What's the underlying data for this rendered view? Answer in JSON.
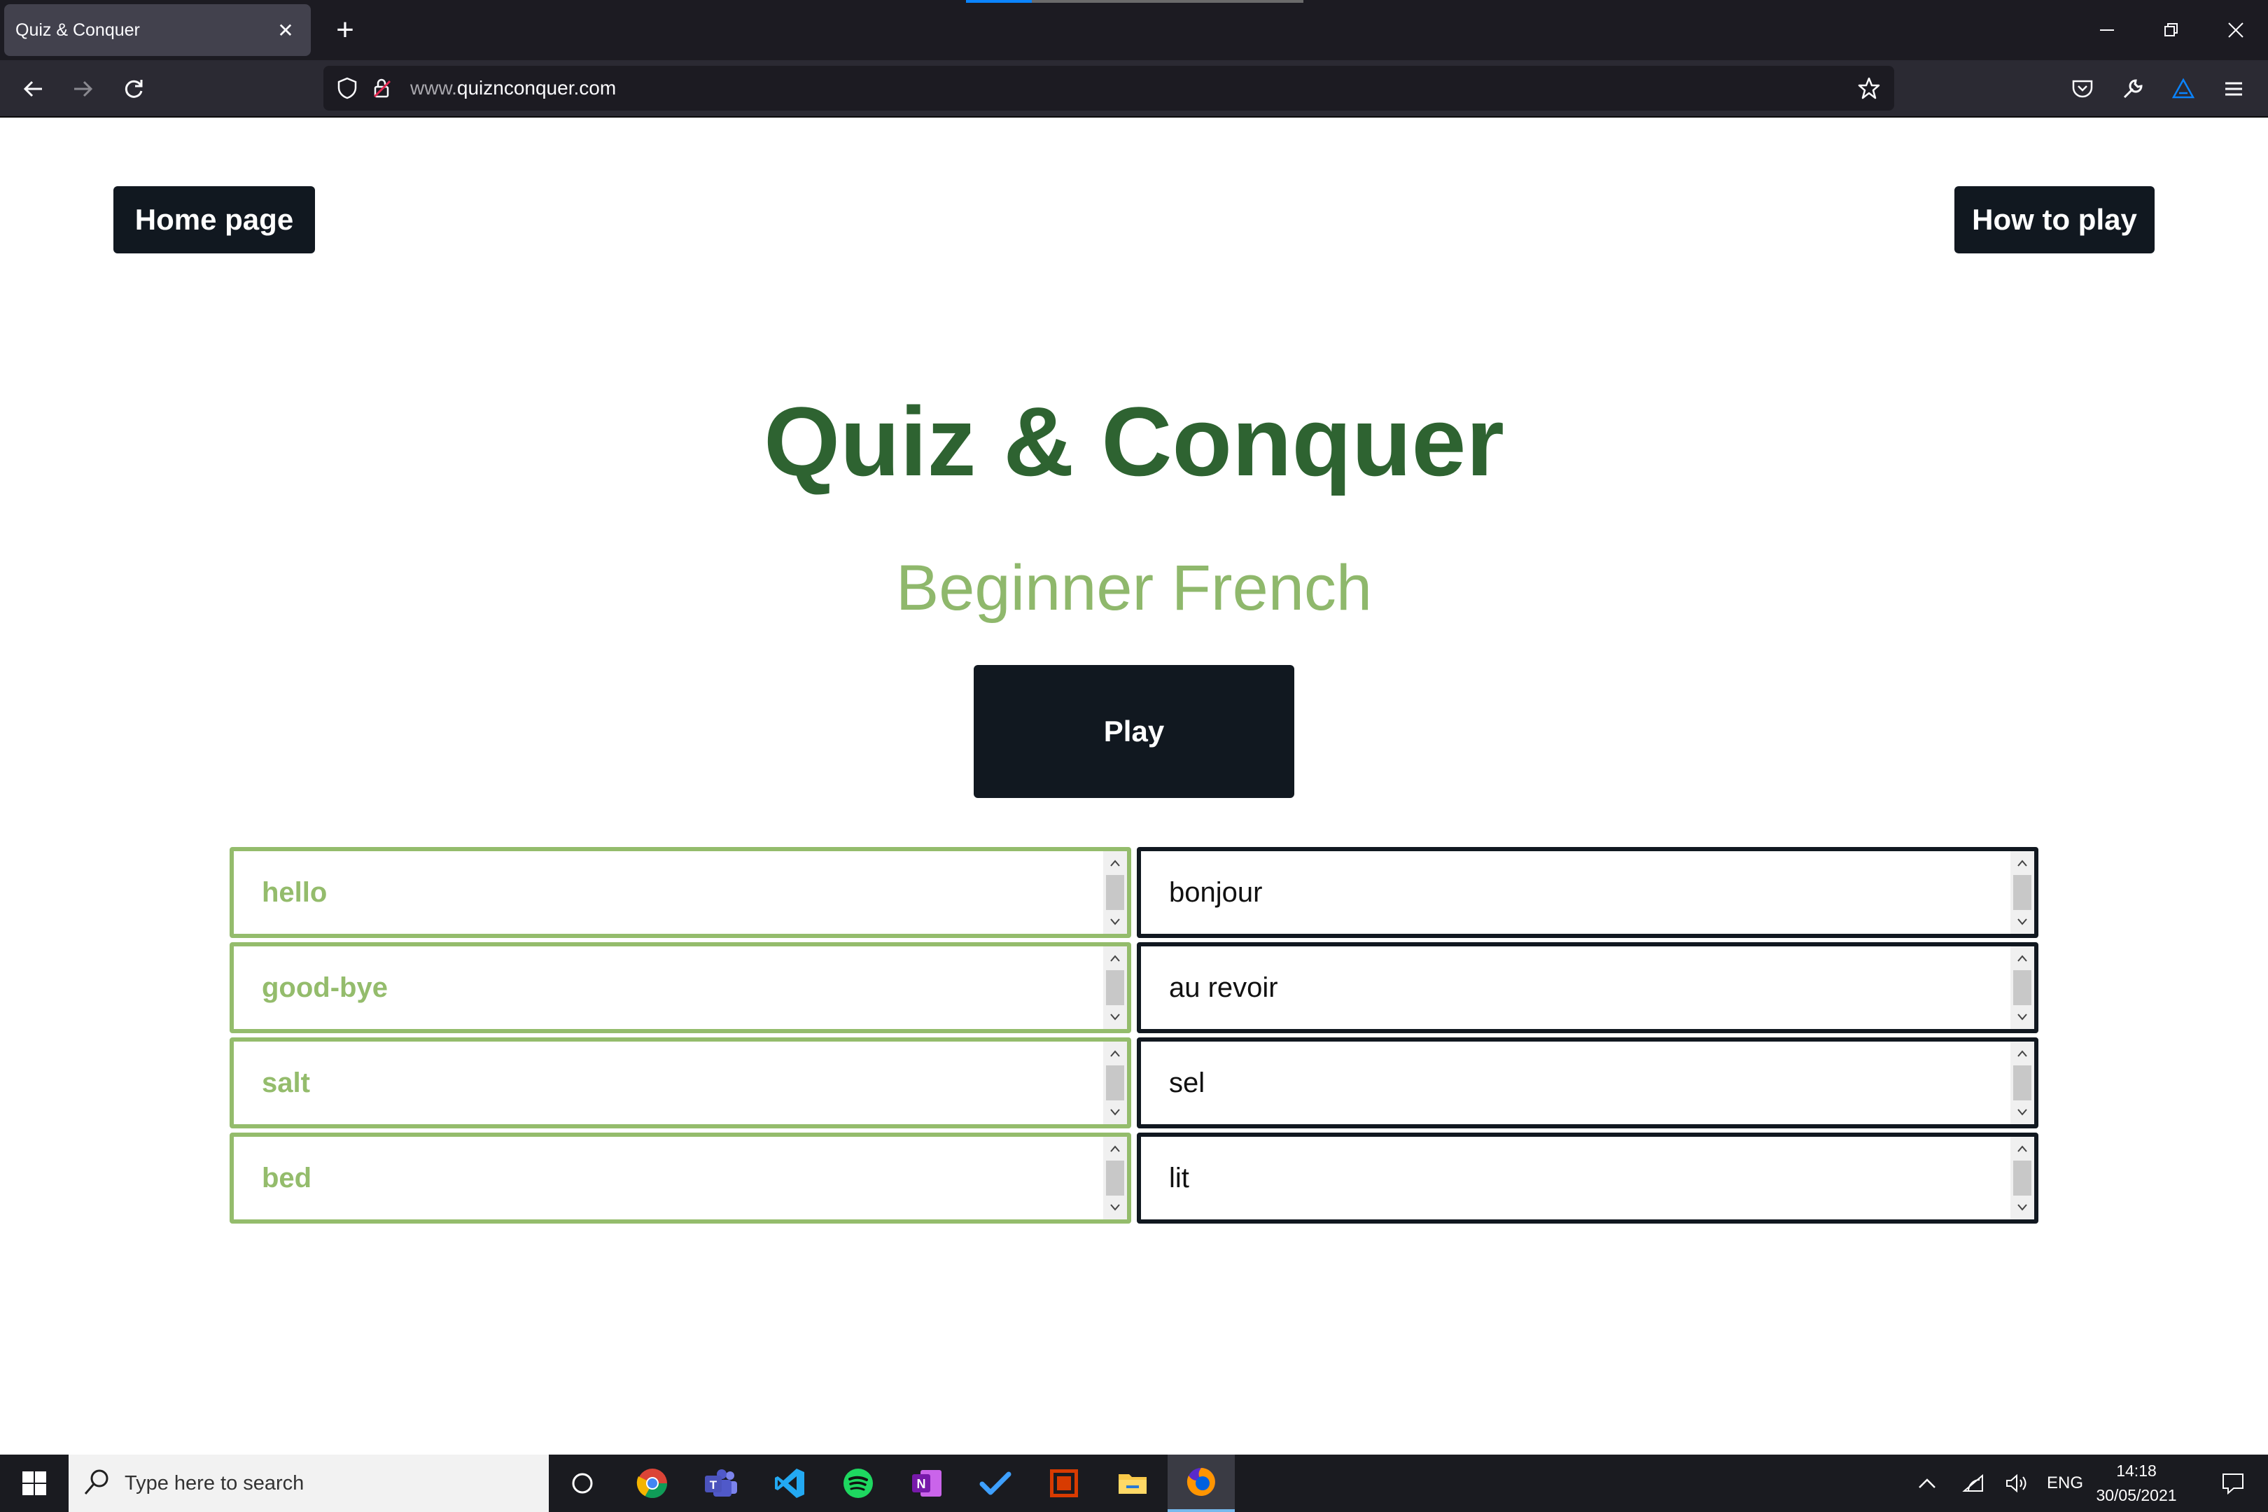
{
  "browser": {
    "tab_title": "Quiz & Conquer",
    "tab_close": "✕",
    "new_tab": "+",
    "url_prefix": "www.",
    "url_domain": "quiznconquer.com"
  },
  "header": {
    "home_label": "Home page",
    "howto_label": "How to play"
  },
  "main": {
    "title": "Quiz & Conquer",
    "subtitle": "Beginner French",
    "play_label": "Play"
  },
  "words": [
    {
      "english": "hello",
      "french": "bonjour"
    },
    {
      "english": "good-bye",
      "french": "au revoir"
    },
    {
      "english": "salt",
      "french": "sel"
    },
    {
      "english": "bed",
      "french": "lit"
    }
  ],
  "taskbar": {
    "search_placeholder": "Type here to search",
    "language": "ENG",
    "time": "14:18",
    "date": "30/05/2021",
    "apps": [
      "cortana-icon",
      "chrome-icon",
      "teams-icon",
      "vscode-icon",
      "spotify-icon",
      "onenote-icon",
      "todo-icon",
      "screen-recorder-icon",
      "file-explorer-icon",
      "firefox-icon"
    ]
  },
  "colors": {
    "title_green": "#2e6331",
    "subtitle_green": "#8fb86c",
    "left_border": "#94bc6c",
    "dark_button": "#111820"
  }
}
